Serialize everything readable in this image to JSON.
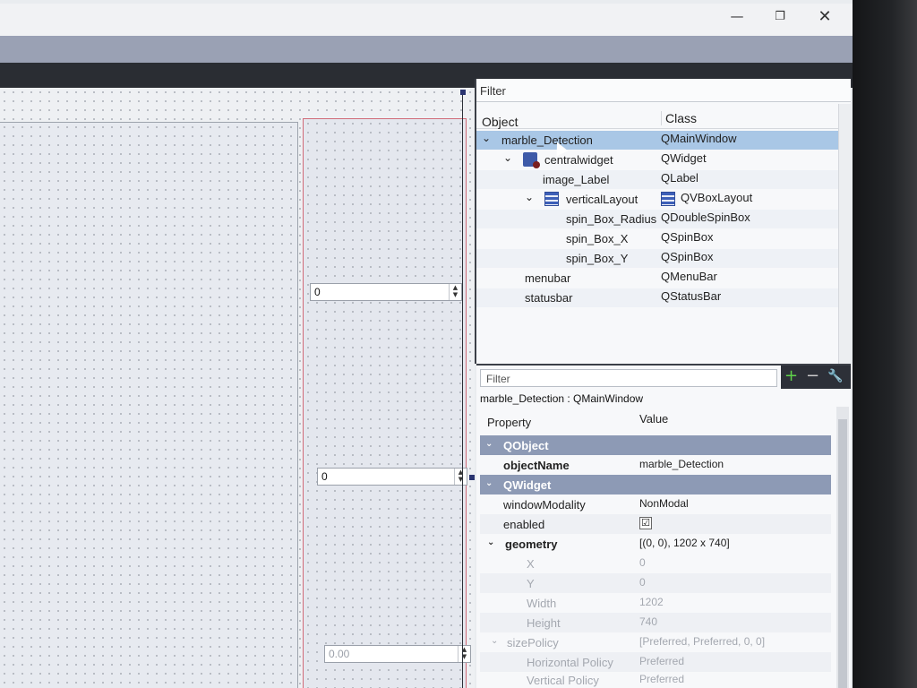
{
  "window": {
    "minimize_glyph": "—",
    "maximize_glyph": "❐",
    "close_glyph": "✕"
  },
  "form": {
    "spin_box_x_value": "0",
    "spin_box_y_value": "0",
    "spin_box_radius_value": "0.00"
  },
  "object_inspector": {
    "filter_label": "Filter",
    "col_object": "Object",
    "col_class": "Class",
    "rows": [
      {
        "object": "marble_Detection",
        "class": "QMainWindow"
      },
      {
        "object": "centralwidget",
        "class": "QWidget"
      },
      {
        "object": "image_Label",
        "class": "QLabel"
      },
      {
        "object": "verticalLayout",
        "class": "QVBoxLayout"
      },
      {
        "object": "spin_Box_Radius",
        "class": "QDoubleSpinBox"
      },
      {
        "object": "spin_Box_X",
        "class": "QSpinBox"
      },
      {
        "object": "spin_Box_Y",
        "class": "QSpinBox"
      },
      {
        "object": "menubar",
        "class": "QMenuBar"
      },
      {
        "object": "statusbar",
        "class": "QStatusBar"
      }
    ]
  },
  "property_editor": {
    "filter_placeholder": "Filter",
    "add_glyph": "+",
    "remove_glyph": "−",
    "configure_glyph": "🔧",
    "caption": "marble_Detection : QMainWindow",
    "col_property": "Property",
    "col_value": "Value",
    "rows": [
      {
        "name": "QObject",
        "value": ""
      },
      {
        "name": "objectName",
        "value": "marble_Detection"
      },
      {
        "name": "QWidget",
        "value": ""
      },
      {
        "name": "windowModality",
        "value": "NonModal"
      },
      {
        "name": "enabled",
        "value": "☑"
      },
      {
        "name": "geometry",
        "value": "[(0, 0), 1202 x 740]"
      },
      {
        "name": "X",
        "value": "0"
      },
      {
        "name": "Y",
        "value": "0"
      },
      {
        "name": "Width",
        "value": "1202"
      },
      {
        "name": "Height",
        "value": "740"
      },
      {
        "name": "sizePolicy",
        "value": "[Preferred, Preferred, 0, 0]"
      },
      {
        "name": "Horizontal Policy",
        "value": "Preferred"
      },
      {
        "name": "Vertical Policy",
        "value": "Preferred"
      }
    ]
  },
  "colors": {
    "selection": "#a9c7e6",
    "section_header": "#8d9ab5",
    "layout_border": "#d06a78"
  }
}
